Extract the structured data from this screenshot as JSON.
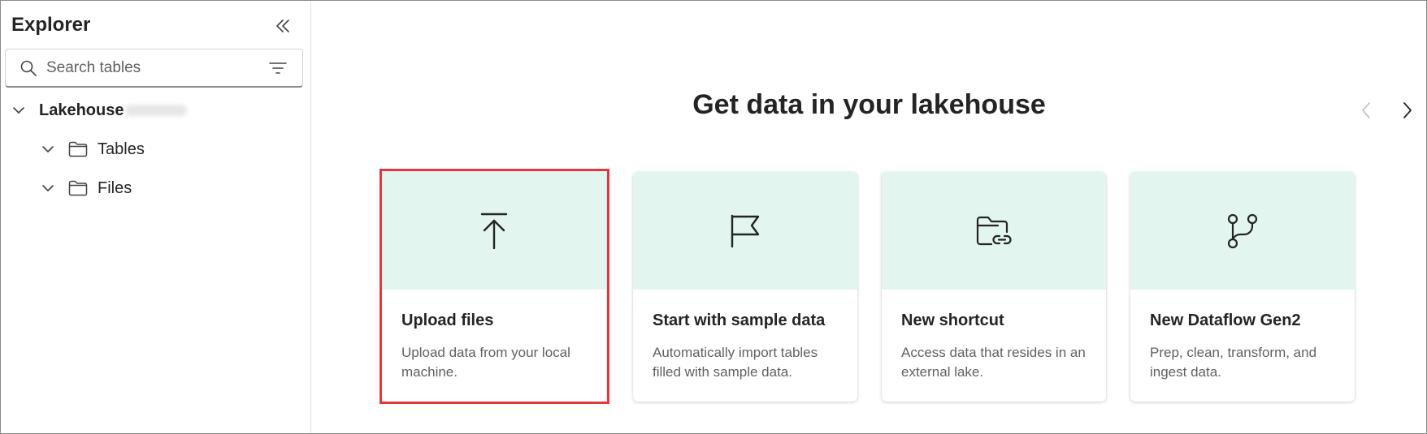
{
  "sidebar": {
    "title": "Explorer",
    "search": {
      "placeholder": "Search tables",
      "value": ""
    },
    "tree": {
      "root_label": "Lakehouse",
      "children": [
        {
          "label": "Tables"
        },
        {
          "label": "Files"
        }
      ]
    }
  },
  "main": {
    "title": "Get data in your lakehouse",
    "cards": [
      {
        "title": "Upload files",
        "description": "Upload data from your local machine.",
        "icon": "upload-icon",
        "highlighted": true
      },
      {
        "title": "Start with sample data",
        "description": "Automatically import tables filled with sample data.",
        "icon": "flag-icon"
      },
      {
        "title": "New shortcut",
        "description": "Access data that resides in an external lake.",
        "icon": "folder-link-icon"
      },
      {
        "title": "New Dataflow Gen2",
        "description": "Prep, clean, transform, and ingest data.",
        "icon": "branch-icon"
      }
    ]
  },
  "colors": {
    "card_banner": "#e2f5ee",
    "highlight_border": "#e0383e",
    "text_primary": "#242424",
    "text_secondary": "#616161"
  }
}
